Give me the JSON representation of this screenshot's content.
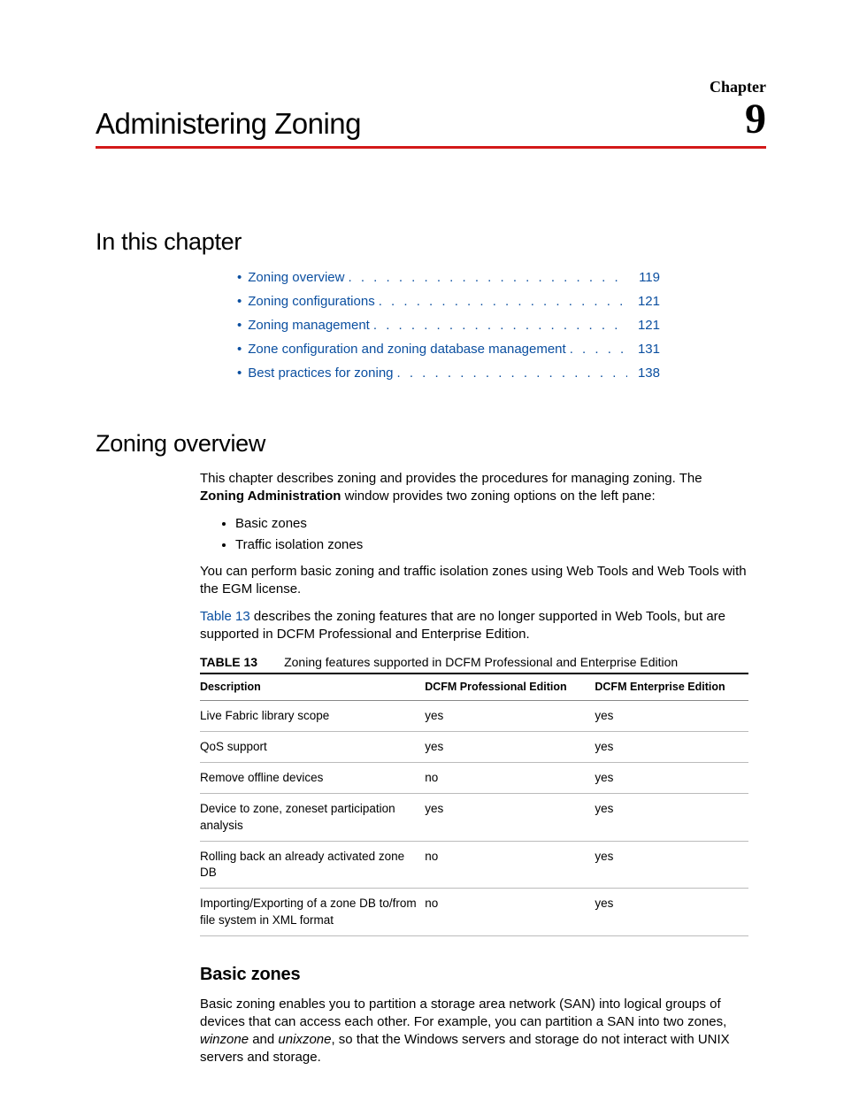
{
  "header": {
    "chapter_label": "Chapter",
    "title": "Administering Zoning",
    "number": "9"
  },
  "sections": {
    "in_this_chapter": "In this chapter",
    "zoning_overview": "Zoning overview",
    "basic_zones": "Basic zones"
  },
  "toc": [
    {
      "label": "Zoning overview",
      "page": "119"
    },
    {
      "label": "Zoning configurations",
      "page": "121"
    },
    {
      "label": "Zoning management",
      "page": "121"
    },
    {
      "label": "Zone configuration and zoning database management",
      "page": "131"
    },
    {
      "label": "Best practices for zoning",
      "page": "138"
    }
  ],
  "overview": {
    "p1a": "This chapter describes zoning and provides the procedures for managing zoning. The ",
    "p1b": "Zoning Administration",
    "p1c": " window provides two zoning options on the left pane:",
    "bullets": [
      "Basic zones",
      "Traffic isolation zones"
    ],
    "p2": "You can perform basic zoning and traffic isolation zones using Web Tools and Web Tools with the EGM license.",
    "p3a": "Table 13",
    "p3b": " describes the zoning features that are no longer supported in Web Tools, but are supported in DCFM Professional and Enterprise Edition."
  },
  "table": {
    "caption_label": "TABLE 13",
    "caption_text": "Zoning features supported in DCFM Professional and Enterprise Edition",
    "headers": [
      "Description",
      "DCFM Professional Edition",
      "DCFM Enterprise Edition"
    ],
    "rows": [
      [
        "Live Fabric library scope",
        "yes",
        "yes"
      ],
      [
        "QoS support",
        "yes",
        "yes"
      ],
      [
        "Remove offline devices",
        "no",
        "yes"
      ],
      [
        "Device to zone, zoneset participation analysis",
        "yes",
        "yes"
      ],
      [
        "Rolling back an already activated zone DB",
        "no",
        "yes"
      ],
      [
        "Importing/Exporting of a zone DB to/from file system in XML format",
        "no",
        "yes"
      ]
    ]
  },
  "basic_zones": {
    "p1a": "Basic zoning enables you to partition a storage area network (SAN) into logical groups of devices that can access each other. For example, you can partition a SAN into two zones, ",
    "p1b": "winzone",
    "p1c": " and ",
    "p1d": "unixzone",
    "p1e": ", so that the Windows servers and storage do not interact with UNIX servers and storage."
  }
}
